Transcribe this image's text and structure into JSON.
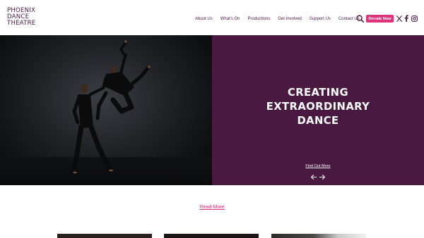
{
  "site": {
    "logo_lines": [
      "PHOENIX",
      "DANCE",
      "THEATRE"
    ]
  },
  "nav": {
    "items": [
      {
        "label": "About Us"
      },
      {
        "label": "What's On"
      },
      {
        "label": "Productions"
      },
      {
        "label": "Get Involved"
      },
      {
        "label": "Support Us"
      },
      {
        "label": "Contact Us"
      }
    ],
    "donate_label": "Donate Now"
  },
  "icons": {
    "search": "search-icon",
    "x": "x-twitter-icon",
    "facebook": "facebook-icon",
    "instagram": "instagram-icon",
    "prev": "arrow-left-icon",
    "next": "arrow-right-icon"
  },
  "hero": {
    "title_lines": [
      "CREATING",
      "EXTRAORDINARY",
      "DANCE"
    ],
    "link_label": "Find Out More"
  },
  "read_more_label": "Read More",
  "colors": {
    "brand_purple": "#4a1942",
    "accent_pink": "#e0317b",
    "background": "#ffffff",
    "hero_text": "#ffffff"
  }
}
